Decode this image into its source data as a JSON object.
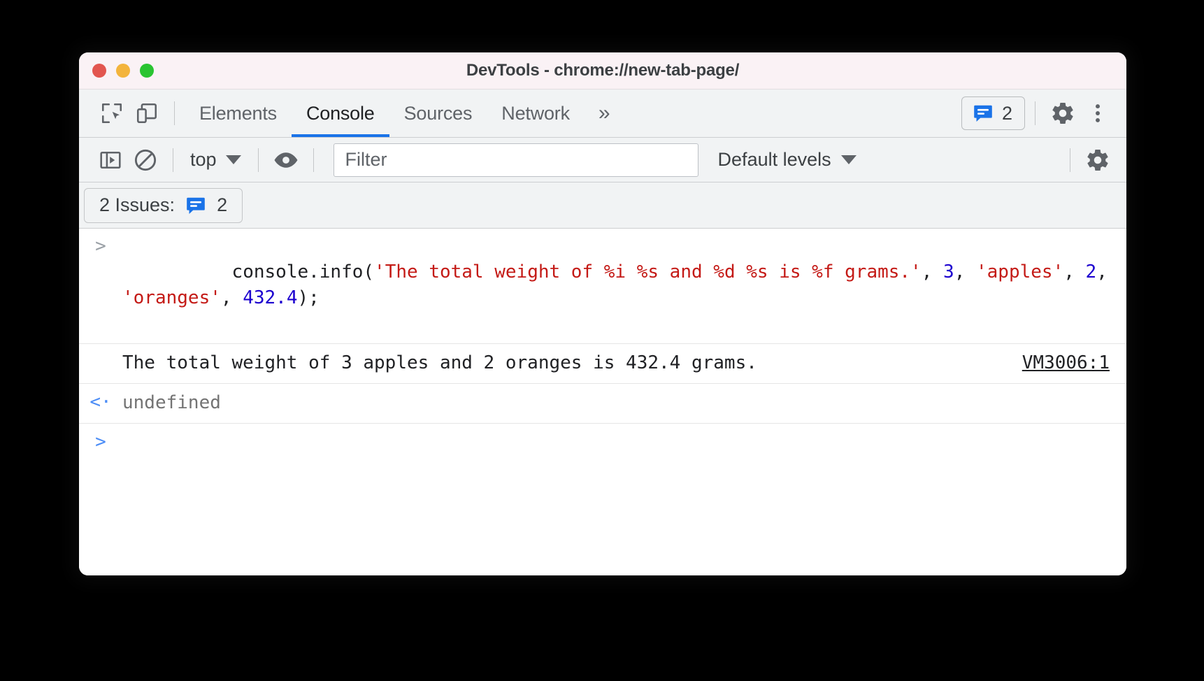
{
  "window": {
    "title": "DevTools - chrome://new-tab-page/",
    "traffic_lights": [
      {
        "name": "close",
        "color": "#e2564f"
      },
      {
        "name": "minimize",
        "color": "#f3b43c"
      },
      {
        "name": "maximize",
        "color": "#29c431"
      }
    ]
  },
  "tabstrip": {
    "inspect_icon": "inspect-element-icon",
    "device_icon": "device-toolbar-icon",
    "tabs": [
      {
        "label": "Elements",
        "active": false
      },
      {
        "label": "Console",
        "active": true
      },
      {
        "label": "Sources",
        "active": false
      },
      {
        "label": "Network",
        "active": false
      }
    ],
    "more_tabs": "»",
    "issues_badge": {
      "icon": "issues-message-icon",
      "count": "2",
      "color": "#1a73e8"
    },
    "settings_icon": "gear-icon",
    "menu_icon": "kebab-menu-icon"
  },
  "toolbar": {
    "sidebar_icon": "console-sidebar-icon",
    "clear_icon": "clear-console-icon",
    "context": {
      "label": "top",
      "caret": "chevron-down-icon"
    },
    "eye_icon": "live-expression-eye-icon",
    "filter": {
      "placeholder": "Filter",
      "value": ""
    },
    "levels": {
      "label": "Default levels",
      "caret": "chevron-down-icon"
    },
    "settings_icon": "console-settings-gear-icon"
  },
  "issues_bar": {
    "label": "2 Issues:",
    "icon": "issues-message-icon",
    "count": "2"
  },
  "console": {
    "accent_blue": "#1a73e8",
    "string_color": "#c41a16",
    "number_color": "#1c00cf",
    "entries": [
      {
        "type": "input",
        "gutter": ">",
        "tokens": [
          {
            "kind": "plain",
            "text": "console.info("
          },
          {
            "kind": "string",
            "text": "'The total weight of %i %s and %d %s is %f grams.'"
          },
          {
            "kind": "plain",
            "text": ", "
          },
          {
            "kind": "number",
            "text": "3"
          },
          {
            "kind": "plain",
            "text": ", "
          },
          {
            "kind": "string",
            "text": "'apples'"
          },
          {
            "kind": "plain",
            "text": ", "
          },
          {
            "kind": "number",
            "text": "2"
          },
          {
            "kind": "plain",
            "text": ", "
          },
          {
            "kind": "string",
            "text": "'oranges'"
          },
          {
            "kind": "plain",
            "text": ", "
          },
          {
            "kind": "number",
            "text": "432.4"
          },
          {
            "kind": "plain",
            "text": ");"
          }
        ]
      },
      {
        "type": "log",
        "gutter": "",
        "text": "The total weight of 3 apples and 2 oranges is 432.4 grams.",
        "source_link": "VM3006:1"
      },
      {
        "type": "result",
        "gutter": "<·",
        "text": "undefined"
      },
      {
        "type": "prompt",
        "gutter": ">",
        "text": ""
      }
    ]
  }
}
